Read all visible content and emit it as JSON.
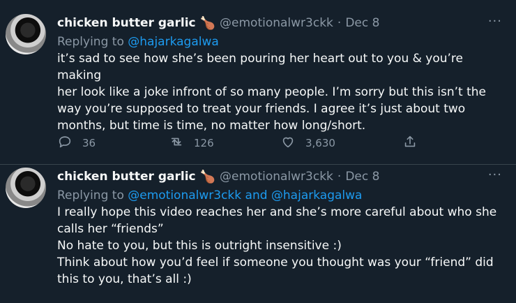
{
  "tweets": [
    {
      "name": "chicken butter garlic",
      "emoji": "🍗",
      "handle": "@emotionalwr3ckk",
      "dot": "·",
      "date": "Dec 8",
      "more": "···",
      "replying_prefix": "Replying to ",
      "replying_to": "@hajarkagalwa",
      "lines": [
        "it’s sad to see how she’s been pouring her heart out to you & you’re making",
        "her look like a joke infront of so many people. I’m sorry but this isn’t the",
        "way you’re supposed to treat your friends. I agree it’s just about two",
        "months, but time is time, no matter how long/short."
      ],
      "replies": "36",
      "retweets": "126",
      "likes": "3,630"
    },
    {
      "name": "chicken butter garlic",
      "emoji": "🍗",
      "handle": "@emotionalwr3ckk",
      "dot": "·",
      "date": "Dec 8",
      "more": "···",
      "replying_prefix": "Replying to ",
      "replying_to": "@emotionalwr3ckk and @hajarkagalwa",
      "lines": [
        "I really hope this video reaches her and she’s more careful about who she",
        "calls her “friends”",
        "No hate to you, but this is outright insensitive :)",
        "Think about how you’d feel if someone you thought was your “friend” did",
        "this to you, that’s all :)"
      ]
    }
  ],
  "icons": {
    "reply": "reply-icon",
    "retweet": "retweet-icon",
    "like": "heart-icon",
    "share": "share-icon"
  },
  "colors": {
    "background": "#15202b",
    "link": "#1d9bf0",
    "muted": "#8b98a5"
  }
}
